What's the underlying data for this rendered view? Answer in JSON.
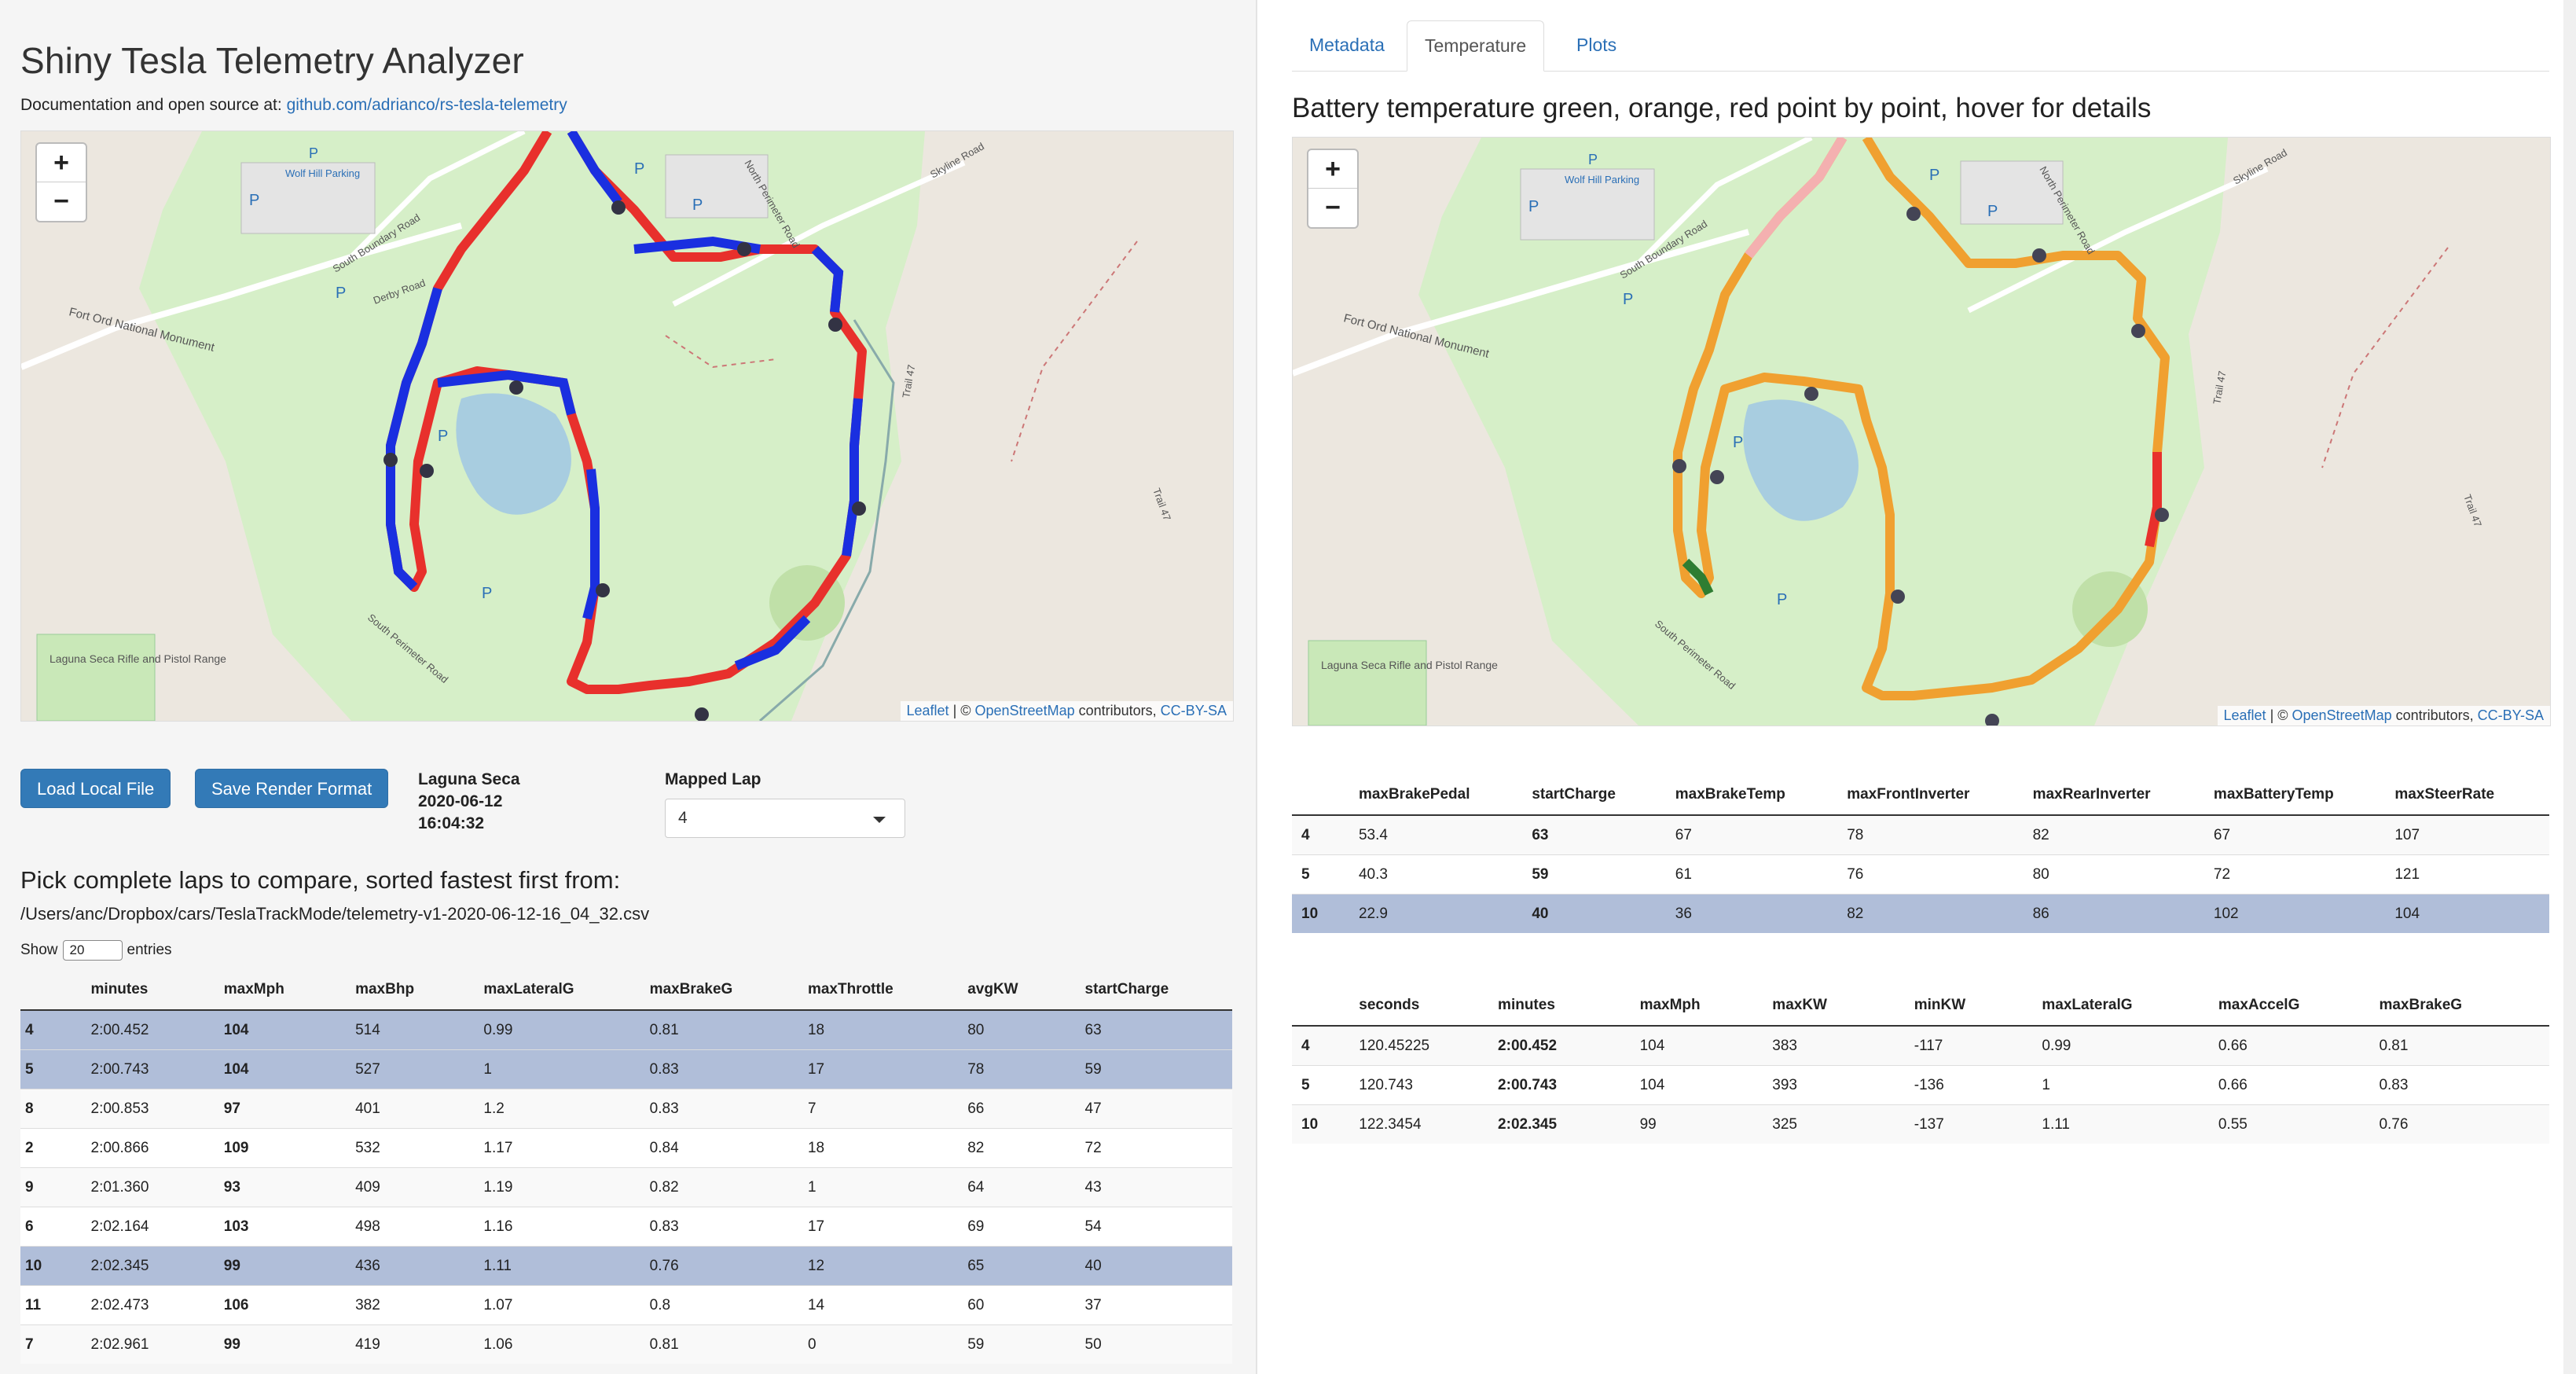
{
  "app": {
    "title": "Shiny Tesla Telemetry Analyzer",
    "doc_prefix": "Documentation and open source at: ",
    "doc_link": "github.com/adrianco/rs-tesla-telemetry"
  },
  "map_common": {
    "zoom_in": "+",
    "zoom_out": "−",
    "attrib_leaflet": "Leaflet",
    "attrib_sep": " | © ",
    "attrib_osm": "OpenStreetMap",
    "attrib_contrib": " contributors, ",
    "attrib_license": "CC-BY-SA",
    "labels": {
      "parking_name": "Wolf Hill Parking",
      "fort_ord": "Fort Ord National Monument",
      "south_boundary": "South Boundary Road",
      "derby": "Derby Road",
      "north_perimeter": "North Perimeter Road",
      "skyline": "Skyline Road",
      "trail47": "Trail 47",
      "trail47b": "Trail 47",
      "south_perimeter": "South Perimeter Road",
      "laguna_range": "Laguna Seca Rifle and Pistol Range",
      "p": "P"
    }
  },
  "controls": {
    "load_button": "Load Local File",
    "save_button": "Save Render Format",
    "location": "Laguna Seca",
    "date": "2020-06-12",
    "time": "16:04:32",
    "mapped_lap_label": "Mapped Lap",
    "mapped_lap_value": "4"
  },
  "laps": {
    "heading": "Pick complete laps to compare, sorted fastest first from:",
    "path": "/Users/anc/Dropbox/cars/TeslaTrackMode/telemetry-v1-2020-06-12-16_04_32.csv",
    "show_prefix": "Show",
    "show_value": "20",
    "show_suffix": "entries",
    "columns": [
      "",
      "minutes",
      "maxMph",
      "maxBhp",
      "maxLateralG",
      "maxBrakeG",
      "maxThrottle",
      "avgKW",
      "startCharge"
    ],
    "rows": [
      {
        "sel": true,
        "cells": [
          "4",
          "2:00.452",
          "104",
          "514",
          "0.99",
          "0.81",
          "18",
          "80",
          "63"
        ]
      },
      {
        "sel": true,
        "cells": [
          "5",
          "2:00.743",
          "104",
          "527",
          "1",
          "0.83",
          "17",
          "78",
          "59"
        ]
      },
      {
        "sel": false,
        "cells": [
          "8",
          "2:00.853",
          "97",
          "401",
          "1.2",
          "0.83",
          "7",
          "66",
          "47"
        ]
      },
      {
        "sel": false,
        "cells": [
          "2",
          "2:00.866",
          "109",
          "532",
          "1.17",
          "0.84",
          "18",
          "82",
          "72"
        ]
      },
      {
        "sel": false,
        "cells": [
          "9",
          "2:01.360",
          "93",
          "409",
          "1.19",
          "0.82",
          "1",
          "64",
          "43"
        ]
      },
      {
        "sel": false,
        "cells": [
          "6",
          "2:02.164",
          "103",
          "498",
          "1.16",
          "0.83",
          "17",
          "69",
          "54"
        ]
      },
      {
        "sel": true,
        "cells": [
          "10",
          "2:02.345",
          "99",
          "436",
          "1.11",
          "0.76",
          "12",
          "65",
          "40"
        ]
      },
      {
        "sel": false,
        "cells": [
          "11",
          "2:02.473",
          "106",
          "382",
          "1.07",
          "0.8",
          "14",
          "60",
          "37"
        ]
      },
      {
        "sel": false,
        "cells": [
          "7",
          "2:02.961",
          "99",
          "419",
          "1.06",
          "0.81",
          "0",
          "59",
          "50"
        ]
      }
    ]
  },
  "tabs": [
    "Metadata",
    "Temperature",
    "Plots"
  ],
  "temperature": {
    "heading": "Battery temperature green, orange, red point by point, hover for details",
    "table1": {
      "columns": [
        "",
        "maxBrakePedal",
        "startCharge",
        "maxBrakeTemp",
        "maxFrontInverter",
        "maxRearInverter",
        "maxBatteryTemp",
        "maxSteerRate"
      ],
      "rows": [
        {
          "sel": false,
          "cells": [
            "4",
            "53.4",
            "63",
            "67",
            "78",
            "82",
            "67",
            "107"
          ]
        },
        {
          "sel": false,
          "cells": [
            "5",
            "40.3",
            "59",
            "61",
            "76",
            "80",
            "72",
            "121"
          ]
        },
        {
          "sel": true,
          "cells": [
            "10",
            "22.9",
            "40",
            "36",
            "82",
            "86",
            "102",
            "104"
          ]
        }
      ]
    },
    "table2": {
      "columns": [
        "",
        "seconds",
        "minutes",
        "maxMph",
        "maxKW",
        "minKW",
        "maxLateralG",
        "maxAccelG",
        "maxBrakeG"
      ],
      "rows": [
        {
          "sel": false,
          "cells": [
            "4",
            "120.45225",
            "2:00.452",
            "104",
            "383",
            "-117",
            "0.99",
            "0.66",
            "0.81"
          ]
        },
        {
          "sel": false,
          "cells": [
            "5",
            "120.743",
            "2:00.743",
            "104",
            "393",
            "-136",
            "1",
            "0.66",
            "0.83"
          ]
        },
        {
          "sel": false,
          "cells": [
            "10",
            "122.3454",
            "2:02.345",
            "99",
            "325",
            "-137",
            "1.11",
            "0.55",
            "0.76"
          ]
        }
      ]
    }
  },
  "colors": {
    "red": "#e8302c",
    "blue": "#1a2fe0",
    "orange": "#f0a030",
    "green": "#2e7d32",
    "park": "#d6efc8",
    "link": "#2a6fb6"
  }
}
